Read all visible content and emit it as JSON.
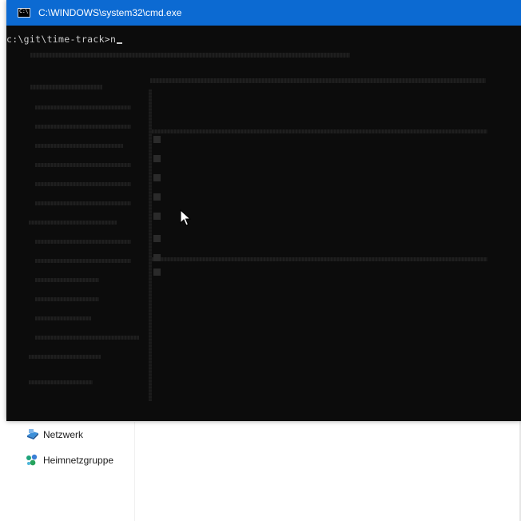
{
  "console": {
    "title": "C:\\WINDOWS\\system32\\cmd.exe",
    "icon_text": "C:\\",
    "prompt_line": "c:\\git\\time-track>n",
    "colors": {
      "titlebar": "#0c6ad2",
      "background": "#0c0c0c",
      "text": "#cccccc"
    }
  },
  "explorer": {
    "nav_items": [
      {
        "label": "Netzwerk",
        "icon": "network-icon"
      },
      {
        "label": "Heimnetzgruppe",
        "icon": "homegroup-icon"
      }
    ]
  }
}
